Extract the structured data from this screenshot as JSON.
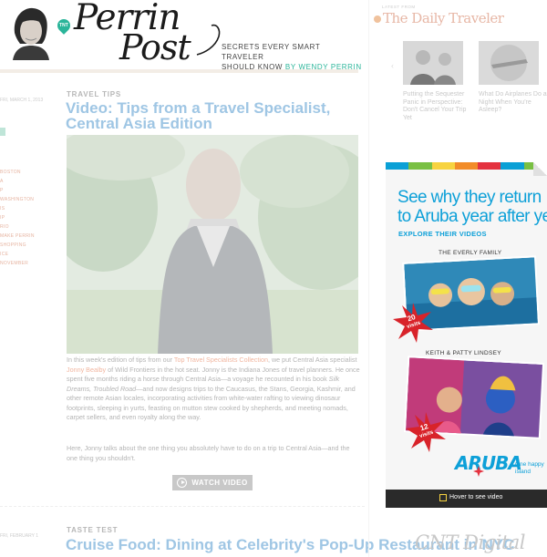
{
  "header": {
    "brand_line1": "Perrin",
    "brand_line2": "Post",
    "badge": "TNT",
    "tagline_line1": "SECRETS EVERY SMART TRAVELER",
    "tagline_line2_prefix": "SHOULD KNOW",
    "tagline_by": "BY WENDY PERRIN"
  },
  "sidebar": {
    "date1": "FRI, MARCH 1, 2013",
    "links": [
      "BOSTON",
      "A",
      "P",
      "WASHINGTON",
      "IS",
      "IP",
      "RIO",
      "MAKE PERRIN",
      "SHOPPING",
      "ICE",
      "NOVEMBER"
    ],
    "date2": "FRI, FEBRUARY 1"
  },
  "article": {
    "kicker": "TRAVEL TIPS",
    "title_line1": "Video: Tips from a Travel Specialist,",
    "title_line2": "Central Asia Edition",
    "p1_a": "In this week's edition of tips from our ",
    "p1_link1": "Top Travel Specialists Collection",
    "p1_b": ", we put Central Asia specialist ",
    "p1_link2": "Jonny Bealby",
    "p1_c": " of Wild Frontiers in the hot seat. Jonny is the Indiana Jones of travel planners. He once spent five months riding a horse through Central Asia—a voyage he recounted in his book ",
    "p1_book": "Silk Dreams, Troubled Road",
    "p1_d": "—and now designs trips to the Caucasus, the Stans, Georgia, Kashmir, and other remote Asian locales, incorporating activities from white-water rafting to viewing dinosaur footprints, sleeping in yurts, feasting on mutton stew cooked by shepherds, and meeting nomads, carpet sellers, and even royalty along the way.",
    "p2": "Here, Jonny talks about the one thing you absolutely have to do on a trip to Central Asia—and the one thing you shouldn't.",
    "watch_label": "WATCH VIDEO"
  },
  "article2": {
    "kicker": "TASTE TEST",
    "title": "Cruise Food: Dining at Celebrity's Pop-Up Restaurant in NYC"
  },
  "right": {
    "latest_from": "LATEST FROM",
    "brand": "The Daily Traveler",
    "stories": [
      {
        "caption": "Putting the Sequester Panic in Perspective: Don't Cancel Your Trip Yet"
      },
      {
        "caption": "What Do Airplanes Do at Night When You're Asleep?"
      }
    ]
  },
  "ad": {
    "headline_line1": "See why they return",
    "headline_line2": "to Aruba year after year",
    "explore": "EXPLORE THEIR VIDEOS",
    "family1": "THE EVERLY FAMILY",
    "family1_visits": "20",
    "family2": "KEITH & PATTY LINDSEY",
    "family2_visits": "12",
    "visits_word": "visits",
    "logo": "ARUBA",
    "logo_tagline1": "One happy",
    "logo_tagline2": "island",
    "hover": "Hover to see video",
    "stripe_colors": [
      "#0aa0d6",
      "#79c043",
      "#f7d340",
      "#f28c28",
      "#e4323f",
      "#0aa0d6",
      "#79c043"
    ]
  },
  "footer_brand": "CNT Digital"
}
